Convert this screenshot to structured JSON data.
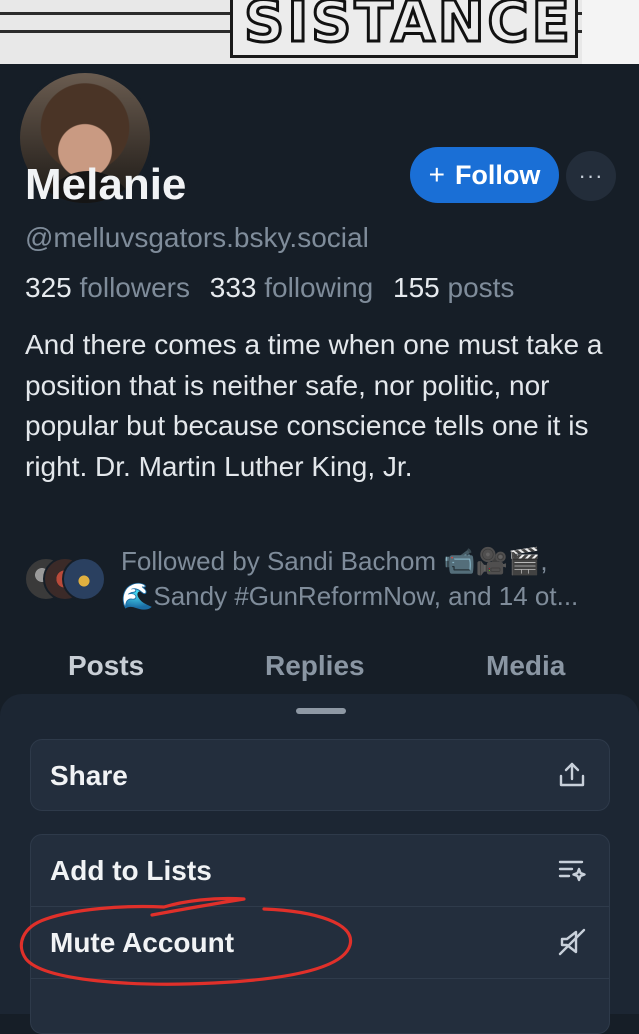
{
  "banner": {
    "text": "SISTANCE"
  },
  "profile": {
    "display_name": "Melanie",
    "handle": "@melluvsgators.bsky.social",
    "followers_count": "325",
    "followers_label": "followers",
    "following_count": "333",
    "following_label": "following",
    "posts_count": "155",
    "posts_label": "posts",
    "bio": "And there comes a time when one must take a position that is neither safe, nor politic, nor popular but because conscience tells one it is right.  Dr. Martin Luther King, Jr.",
    "followed_by_line1": "Followed by Sandi Bachom 📹🎥🎬,",
    "followed_by_line2": "🌊Sandy #GunReformNow, and 14 ot..."
  },
  "actions": {
    "follow_label": "Follow",
    "follow_icon": "plus-icon",
    "more_icon": "ellipsis-icon",
    "more_label": "···"
  },
  "tabs": [
    {
      "label": "Posts"
    },
    {
      "label": "Replies"
    },
    {
      "label": "Media"
    }
  ],
  "sheet": {
    "items": [
      {
        "label": "Share",
        "icon": "share-icon"
      },
      {
        "label": "Add to Lists",
        "icon": "list-sparkle-icon"
      },
      {
        "label": "Mute Account",
        "icon": "mute-speaker-icon"
      }
    ]
  },
  "colors": {
    "accent": "#1a6fd6",
    "annotation": "#e0302a",
    "background": "#161e27",
    "sheet": "#1c2633"
  }
}
